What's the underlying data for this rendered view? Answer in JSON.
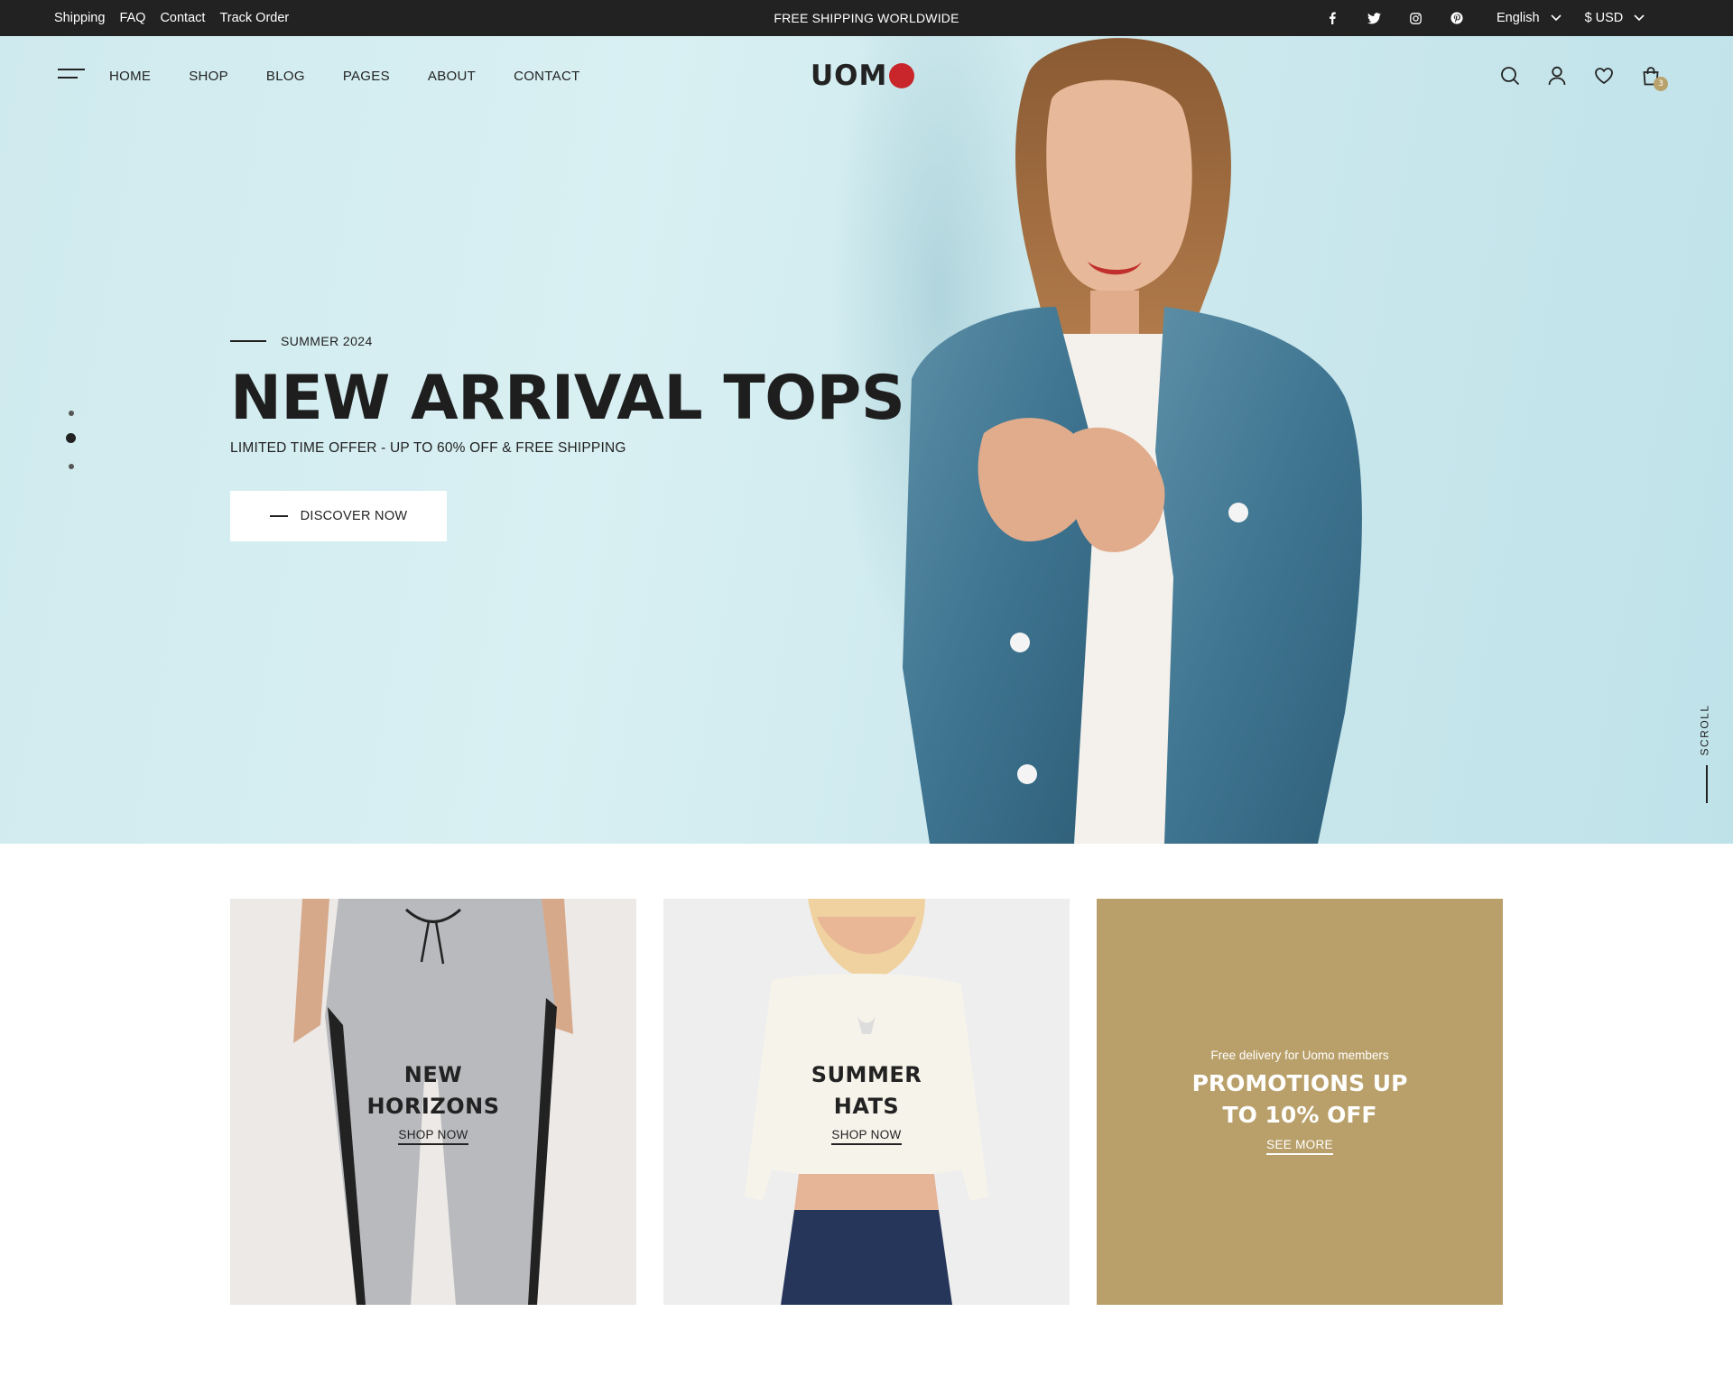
{
  "topbar": {
    "links": [
      "Shipping",
      "FAQ",
      "Contact",
      "Track Order"
    ],
    "promo": "FREE SHIPPING WORLDWIDE",
    "social": [
      "facebook-icon",
      "twitter-icon",
      "instagram-icon",
      "pinterest-icon"
    ],
    "language": "English",
    "currency": "$ USD"
  },
  "nav": {
    "menu": [
      "HOME",
      "SHOP",
      "BLOG",
      "PAGES",
      "ABOUT",
      "CONTACT"
    ],
    "logo": "UOM",
    "cart_count": "3",
    "icons": [
      "search-icon",
      "user-icon",
      "heart-icon",
      "bag-icon"
    ]
  },
  "hero": {
    "eyebrow": "SUMMER 2024",
    "title": "NEW ARRIVAL TOPS",
    "subtitle": "LIMITED TIME OFFER - UP TO 60% OFF & FREE SHIPPING",
    "cta": "DISCOVER NOW",
    "scroll_label": "SCROLL",
    "slide_count": 3,
    "active_slide": 2
  },
  "tiles": [
    {
      "title_line1": "NEW",
      "title_line2": "HORIZONS",
      "link": "SHOP NOW"
    },
    {
      "title_line1": "SUMMER",
      "title_line2": "HATS",
      "link": "SHOP NOW"
    },
    {
      "small": "Free delivery for Uomo members",
      "title_line1": "PROMOTIONS UP",
      "title_line2": "TO 10% OFF",
      "link": "SEE MORE"
    }
  ],
  "colors": {
    "topbar": "#222222",
    "hero_bg": "#cfeaee",
    "accent_gold": "#b9a06a",
    "logo_red": "#c8262b"
  }
}
